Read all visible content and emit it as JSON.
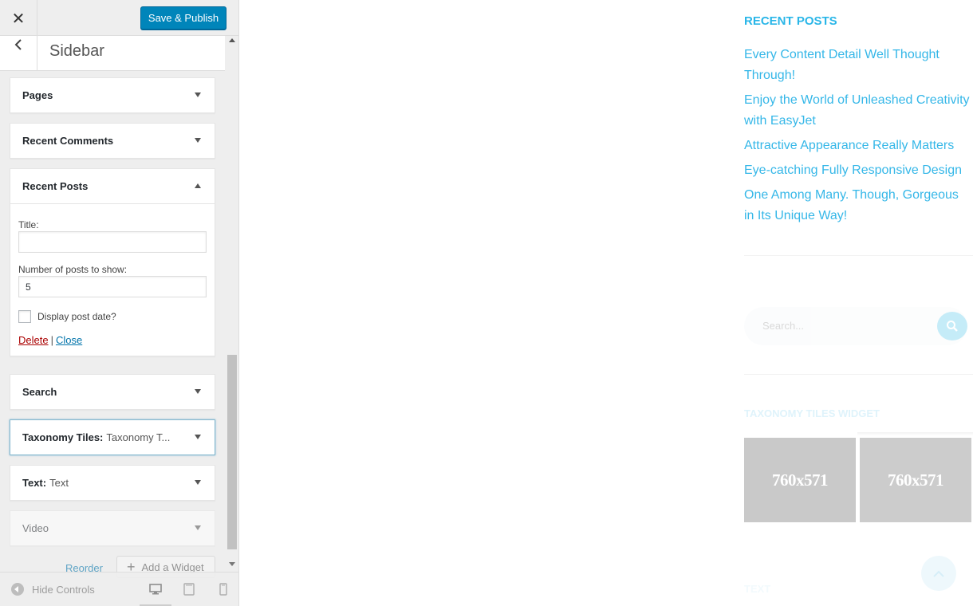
{
  "header": {
    "close_label": "✕",
    "publish_label": "Save & Publish"
  },
  "section": {
    "title": "Sidebar"
  },
  "widgets": [
    {
      "title": "Pages",
      "subtitle": ""
    },
    {
      "title": "Recent Comments",
      "subtitle": ""
    },
    {
      "title": "Recent Posts",
      "subtitle": "",
      "expanded": true
    },
    {
      "title": "Search",
      "subtitle": ""
    },
    {
      "title": "Taxonomy Tiles:",
      "subtitle": "Taxonomy T..."
    },
    {
      "title": "Text:",
      "subtitle": "Text"
    },
    {
      "title": "Video",
      "subtitle": ""
    }
  ],
  "recent_posts_form": {
    "title_label": "Title:",
    "title_value": "",
    "number_label": "Number of posts to show:",
    "number_value": "5",
    "display_date_label": "Display post date?",
    "display_date_checked": false,
    "delete_label": "Delete",
    "separator": "|",
    "close_label": "Close"
  },
  "bottom_actions": {
    "reorder_label": "Reorder",
    "add_widget_label": "Add a Widget"
  },
  "footer": {
    "hide_controls_label": "Hide Controls",
    "devices": [
      "desktop-icon",
      "tablet-icon",
      "mobile-icon"
    ],
    "active_device": "desktop"
  },
  "preview": {
    "recent_posts_title": "RECENT POSTS",
    "posts": [
      "Every Content Detail Well Thought Through!",
      "Enjoy the World of Unleashed Creativity with EasyJet",
      "Attractive Appearance Really Matters",
      "Eye-catching Fully Responsive Design",
      "One Among Many. Though, Gorgeous in Its Unique Way!"
    ],
    "search_placeholder": "Search...",
    "taxonomy_title": "TAXONOMY TILES WIDGET",
    "tiles": [
      "760x571",
      "760x571"
    ],
    "text_title": "TEXT"
  },
  "colors": {
    "accent": "#29b6e8",
    "publish_button": "#0085ba",
    "delete_link": "#aa0000",
    "close_link": "#0073aa"
  }
}
